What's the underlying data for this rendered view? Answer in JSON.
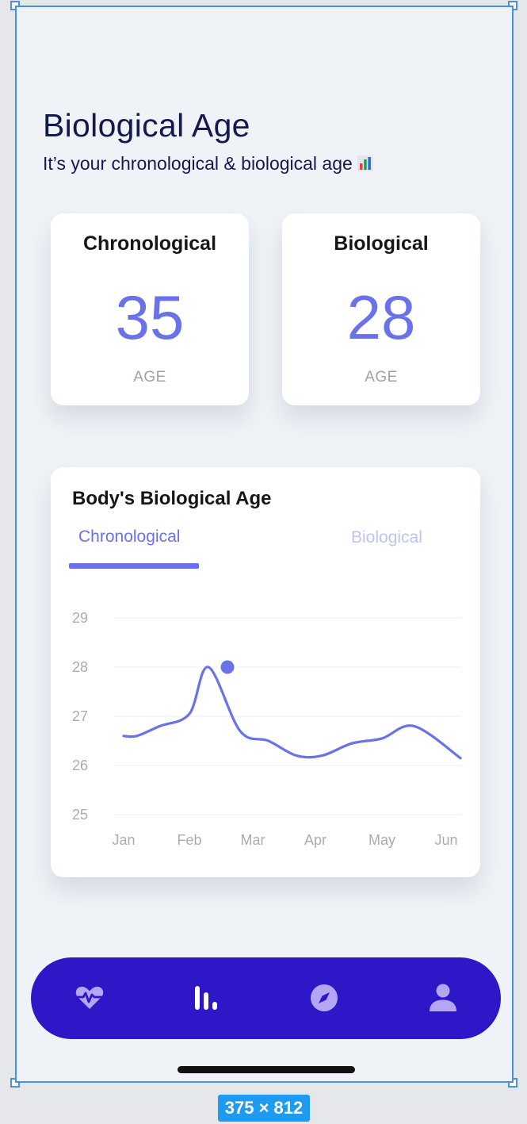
{
  "header": {
    "title": "Biological Age",
    "subtitle": "It’s your chronological & biological age"
  },
  "stats": [
    {
      "label": "Chronological",
      "value": "35",
      "unit": "AGE"
    },
    {
      "label": "Biological",
      "value": "28",
      "unit": "AGE"
    }
  ],
  "chart_card": {
    "title": "Body's Biological Age",
    "tabs": [
      {
        "label": "Chronological",
        "active": true
      },
      {
        "label": "Biological",
        "active": false
      }
    ]
  },
  "chart_data": {
    "type": "line",
    "x_labels": [
      "Jan",
      "Feb",
      "Mar",
      "Apr",
      "May",
      "Jun"
    ],
    "y_ticks": [
      25,
      26,
      27,
      28,
      29
    ],
    "ylim": [
      25,
      29
    ],
    "x": [
      0,
      0.2,
      0.55,
      1.0,
      1.3,
      1.8,
      2.25,
      2.7,
      3.1,
      3.55,
      4.0,
      4.5,
      5.0
    ],
    "y": [
      26.6,
      26.6,
      26.8,
      27.05,
      28.0,
      26.7,
      26.5,
      26.2,
      26.2,
      26.45,
      26.55,
      26.8,
      26.15
    ],
    "highlight": {
      "x": 1.6,
      "y": 28.0
    },
    "color": "#6a72ea",
    "grid": true
  },
  "nav": {
    "items": [
      {
        "icon": "heart-pulse-icon",
        "active": false
      },
      {
        "icon": "bar-chart-icon",
        "active": true
      },
      {
        "icon": "compass-icon",
        "active": false
      },
      {
        "icon": "user-icon",
        "active": false
      }
    ],
    "active_color": "#ffffff",
    "inactive_color": "#b4a6f4"
  },
  "canvas_label": "375 × 812"
}
